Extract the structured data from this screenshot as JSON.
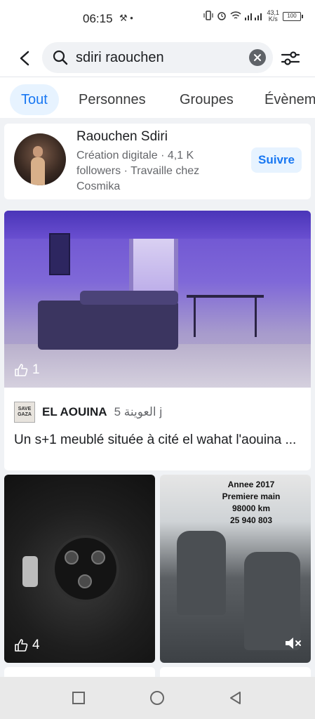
{
  "status_bar": {
    "time": "06:15",
    "left_icons": "⚒ •",
    "speed": "43,1\nK/s",
    "battery": "100"
  },
  "search": {
    "query": "sdiri raouchen",
    "icons": [
      "back-arrow-icon",
      "search-icon",
      "clear-icon",
      "filter-icon"
    ]
  },
  "tabs": [
    {
      "label": "Tout",
      "active": true
    },
    {
      "label": "Personnes",
      "active": false
    },
    {
      "label": "Groupes",
      "active": false
    },
    {
      "label": "Évènem",
      "active": false
    }
  ],
  "person_result": {
    "name": "Raouchen Sdiri",
    "meta": "Création digitale · 4,1 K followers · Travaille chez Cosmika",
    "follow_label": "Suivre"
  },
  "post": {
    "likes": "1",
    "badge_text": "SAVE GAZA",
    "author": "EL AOUINA",
    "author_extra": "5 العوينة j",
    "text": "Un s+1 meublé située à cité el wahat l'aouina ..."
  },
  "grid": {
    "card1_likes": "4",
    "card2_overlay": [
      "Annee 2017",
      "Premiere main",
      "98000 km",
      "25 940 803"
    ]
  },
  "colors": {
    "accent": "#1877f2",
    "accent_bg": "#e7f3ff",
    "background": "#f0f2f5"
  }
}
